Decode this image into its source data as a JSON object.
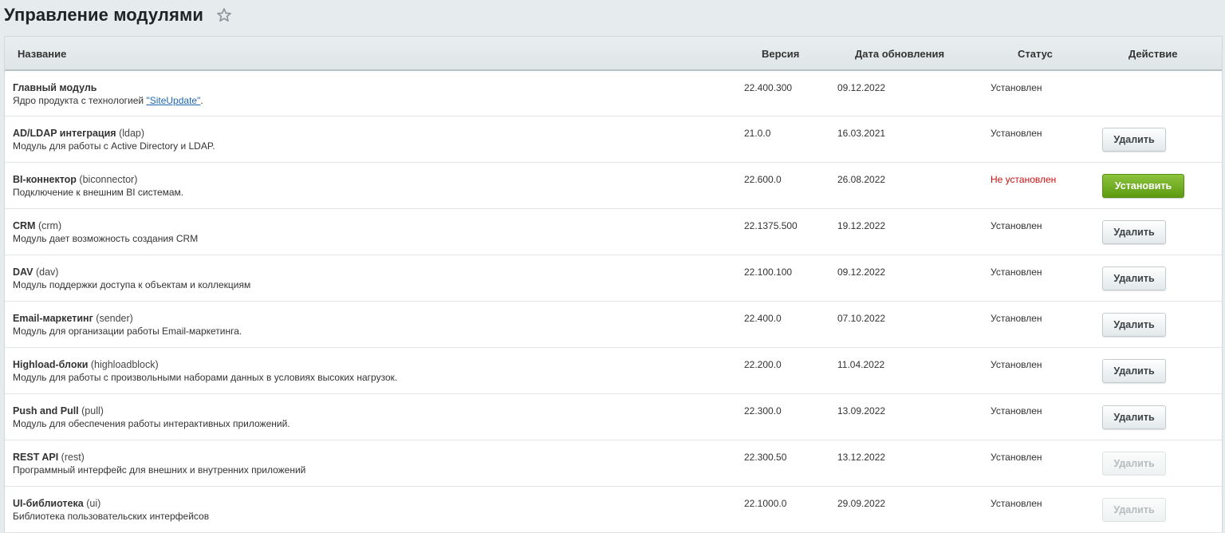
{
  "page": {
    "title": "Управление модулями"
  },
  "table": {
    "headers": {
      "name": "Название",
      "version": "Версия",
      "date": "Дата обновления",
      "status": "Статус",
      "action": "Действие"
    },
    "rows": [
      {
        "title": "Главный модуль",
        "code": "",
        "desc": "Ядро продукта с технологией ",
        "desc_link": "\"SiteUpdate\"",
        "desc_tail": ".",
        "version": "22.400.300",
        "date": "09.12.2022",
        "status": "Установлен",
        "action": ""
      },
      {
        "title": "AD/LDAP интеграция",
        "code": "(ldap)",
        "desc": "Модуль для работы с Active Directory и LDAP.",
        "version": "21.0.0",
        "date": "16.03.2021",
        "status": "Установлен",
        "action": "Удалить"
      },
      {
        "title": "BI-коннектор",
        "code": "(biconnector)",
        "desc": "Подключение к внешним BI системам.",
        "version": "22.600.0",
        "date": "26.08.2022",
        "status": "Не установлен",
        "action": "Установить"
      },
      {
        "title": "CRM",
        "code": "(crm)",
        "desc": "Модуль дает возможность создания CRM",
        "version": "22.1375.500",
        "date": "19.12.2022",
        "status": "Установлен",
        "action": "Удалить"
      },
      {
        "title": "DAV",
        "code": "(dav)",
        "desc": "Модуль поддержки доступа к объектам и коллекциям",
        "version": "22.100.100",
        "date": "09.12.2022",
        "status": "Установлен",
        "action": "Удалить"
      },
      {
        "title": "Email-маркетинг",
        "code": "(sender)",
        "desc": "Модуль для организации работы Email-маркетинга.",
        "version": "22.400.0",
        "date": "07.10.2022",
        "status": "Установлен",
        "action": "Удалить"
      },
      {
        "title": "Highload-блоки",
        "code": "(highloadblock)",
        "desc": "Модуль для работы с произвольными наборами данных в условиях высоких нагрузок.",
        "version": "22.200.0",
        "date": "11.04.2022",
        "status": "Установлен",
        "action": "Удалить"
      },
      {
        "title": "Push and Pull",
        "code": "(pull)",
        "desc": "Модуль для обеспечения работы интерактивных приложений.",
        "version": "22.300.0",
        "date": "13.09.2022",
        "status": "Установлен",
        "action": "Удалить"
      },
      {
        "title": "REST API",
        "code": "(rest)",
        "desc": "Программный интерфейс для внешних и внутренних приложений",
        "version": "22.300.50",
        "date": "13.12.2022",
        "status": "Установлен",
        "action": "Удалить"
      },
      {
        "title": "UI-библиотека",
        "code": "(ui)",
        "desc": "Библиотека пользовательских интерфейсов",
        "version": "22.1000.0",
        "date": "29.09.2022",
        "status": "Установлен",
        "action": "Удалить"
      }
    ]
  },
  "colors": {
    "status_not_installed": "#cc1111",
    "install_button": "#6fae1f",
    "link": "#2067b0"
  },
  "icons": {
    "favorite": "star-outline-icon"
  }
}
